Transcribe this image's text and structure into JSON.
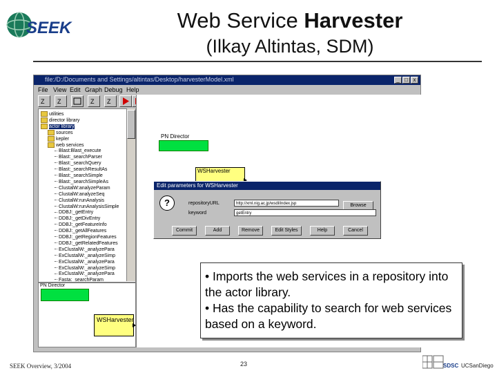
{
  "slide": {
    "logo_text": "SEEK",
    "title_plain": "Web Service ",
    "title_bold": "Harvester",
    "subtitle": "(Ilkay Altintas, SDM)",
    "footer_left": "SEEK Overview, 3/2004",
    "page_number": "23",
    "footer_logo_1": "SDSC",
    "footer_logo_2": "UCSanDiego"
  },
  "window": {
    "title": "file:/D:/Documents and Settings/altintas/Desktop/harvesterModel.xml",
    "controls": [
      "_",
      "□",
      "x"
    ],
    "menu": [
      "File",
      "View",
      "Edit",
      "Graph",
      "Debug",
      "Help"
    ]
  },
  "tree": {
    "items": [
      {
        "label": "utilities",
        "type": "folder",
        "indent": 0
      },
      {
        "label": "director library",
        "type": "folder",
        "indent": 0
      },
      {
        "label": "actor library",
        "type": "folder",
        "indent": 0,
        "selected": true
      },
      {
        "label": "sources",
        "type": "folder",
        "indent": 1
      },
      {
        "label": "kepler",
        "type": "folder",
        "indent": 1
      },
      {
        "label": "web services",
        "type": "folder",
        "indent": 1
      },
      {
        "label": "Blast:Blast_execute",
        "type": "leaf",
        "indent": 2
      },
      {
        "label": "Blast:_searchParser",
        "type": "leaf",
        "indent": 2
      },
      {
        "label": "Blast:_searchQuery",
        "type": "leaf",
        "indent": 2
      },
      {
        "label": "Blast:_searchResultAs",
        "type": "leaf",
        "indent": 2
      },
      {
        "label": "Blast:_searchSimple",
        "type": "leaf",
        "indent": 2
      },
      {
        "label": "Blast:_searchSimpleAs",
        "type": "leaf",
        "indent": 2
      },
      {
        "label": "ClustalW:analyzeParam",
        "type": "leaf",
        "indent": 2
      },
      {
        "label": "ClustalW:analyzeSeq",
        "type": "leaf",
        "indent": 2
      },
      {
        "label": "ClustalW:runAnalysis",
        "type": "leaf",
        "indent": 2
      },
      {
        "label": "ClustalW:runAnalysisSimple",
        "type": "leaf",
        "indent": 2
      },
      {
        "label": "DDBJ:_getEntry",
        "type": "leaf",
        "indent": 2
      },
      {
        "label": "DDBJ:_getDivEntry",
        "type": "leaf",
        "indent": 2
      },
      {
        "label": "DDBJ:_getFeatureInfo",
        "type": "leaf",
        "indent": 2
      },
      {
        "label": "DDBJ:_getAllFeatures",
        "type": "leaf",
        "indent": 2
      },
      {
        "label": "DDBJ:_getRegionFeatures",
        "type": "leaf",
        "indent": 2
      },
      {
        "label": "DDBJ:_getRelatedFeatures",
        "type": "leaf",
        "indent": 2
      },
      {
        "label": "ExClustalW:_analyzePara",
        "type": "leaf",
        "indent": 2
      },
      {
        "label": "ExClustalW:_analyzeSimp",
        "type": "leaf",
        "indent": 2
      },
      {
        "label": "ExClustalW:_analyzePara",
        "type": "leaf",
        "indent": 2
      },
      {
        "label": "ExClustalW:_analyzeSimp",
        "type": "leaf",
        "indent": 2
      },
      {
        "label": "ExClustalW:_analyzePara",
        "type": "leaf",
        "indent": 2
      },
      {
        "label": "Fasta:_searchParam",
        "type": "leaf",
        "indent": 2
      }
    ]
  },
  "overview": {
    "director_label": "PN Director",
    "ws_label": "WSHarvester"
  },
  "canvas": {
    "director_label": "PN Director",
    "ws_label": "WSHarvester"
  },
  "dialog": {
    "title": "Edit parameters for WSHarvester",
    "field1_label": "repositoryURL",
    "field1_value": "http://xml.nig.ac.jp/wsdl/index.jsp",
    "field2_label": "keyword",
    "field2_value": "getEntry",
    "browse": "Browse",
    "buttons": [
      "Commit",
      "Add",
      "Remove",
      "Edit Styles",
      "Help",
      "Cancel"
    ]
  },
  "bullets": [
    "• Imports the web services in a repository into the actor library.",
    "• Has the capability to search for web services based on a keyword."
  ],
  "colors": {
    "titlebar": "#0a246a",
    "director": "#00e040",
    "actor": "#ffff80",
    "window_bg": "#c0c0c0"
  }
}
